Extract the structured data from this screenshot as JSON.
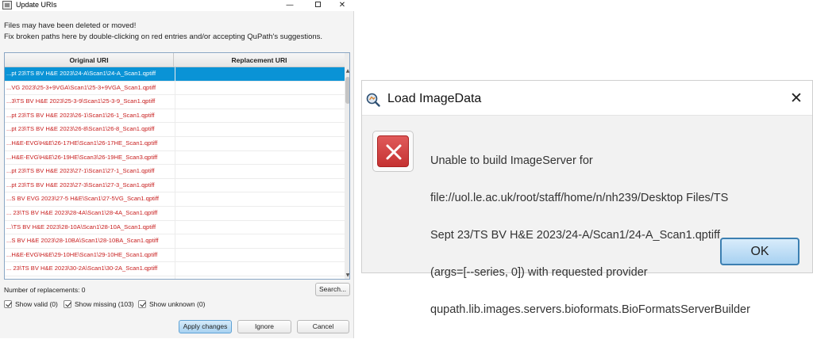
{
  "update_uris": {
    "title": "Update URIs",
    "controls": {
      "minimize": "—",
      "close": "✕"
    },
    "instructions": [
      "Files may have been deleted or moved!",
      "Fix broken paths here by double-clicking on red entries and/or accepting QuPath's suggestions."
    ],
    "columns": [
      "Original URI",
      "Replacement URI"
    ],
    "rows": [
      {
        "original": "...pt 23\\TS BV H&E 2023\\24-A\\Scan1\\24-A_Scan1.qptiff",
        "replacement": "",
        "selected": true
      },
      {
        "original": "...VG 2023\\25-3+9VGA\\Scan1\\25-3+9VGA_Scan1.qptiff",
        "replacement": ""
      },
      {
        "original": "...3\\TS BV H&E 2023\\25-3-9\\Scan1\\25-3-9_Scan1.qptiff",
        "replacement": ""
      },
      {
        "original": "...pt 23\\TS BV H&E 2023\\26-1\\Scan1\\26-1_Scan1.qptiff",
        "replacement": ""
      },
      {
        "original": "...pt 23\\TS BV H&E 2023\\26-8\\Scan1\\26-8_Scan1.qptiff",
        "replacement": ""
      },
      {
        "original": "...H&E-EVG\\H&E\\26-17HE\\Scan1\\26-17HE_Scan1.qptiff",
        "replacement": ""
      },
      {
        "original": "...H&E-EVG\\H&E\\26-19HE\\Scan3\\26-19HE_Scan3.qptiff",
        "replacement": ""
      },
      {
        "original": "...pt 23\\TS BV H&E 2023\\27-1\\Scan1\\27-1_Scan1.qptiff",
        "replacement": ""
      },
      {
        "original": "...pt 23\\TS BV H&E 2023\\27-3\\Scan1\\27-3_Scan1.qptiff",
        "replacement": ""
      },
      {
        "original": "...S BV EVG 2023\\27-5 H&E\\Scan1\\27-5VG_Scan1.qptiff",
        "replacement": ""
      },
      {
        "original": "... 23\\TS BV H&E 2023\\28-4A\\Scan1\\28-4A_Scan1.qptiff",
        "replacement": ""
      },
      {
        "original": "...\\TS BV H&E 2023\\28-10A\\Scan1\\28-10A_Scan1.qptiff",
        "replacement": ""
      },
      {
        "original": "...S BV H&E 2023\\28-10BA\\Scan1\\28-10BA_Scan1.qptiff",
        "replacement": ""
      },
      {
        "original": "...H&E-EVG\\H&E\\29-10HE\\Scan1\\29-10HE_Scan1.qptiff",
        "replacement": ""
      },
      {
        "original": "... 23\\TS BV H&E 2023\\30-2A\\Scan1\\30-2A_Scan1.qptiff",
        "replacement": ""
      },
      {
        "original": "...pt 23\\TS BV H&E 2023\\30-3\\Scan1\\30-3_Scan1.qptiff",
        "replacement": ""
      }
    ],
    "num_replacements_label": "Number of replacements: 0",
    "search_label": "Search...",
    "checkboxes": [
      {
        "label": "Show valid (0)",
        "checked": true
      },
      {
        "label": "Show missing (103)",
        "checked": true
      },
      {
        "label": "Show unknown (0)",
        "checked": true
      }
    ],
    "buttons": {
      "apply": "Apply changes",
      "ignore": "Ignore",
      "cancel": "Cancel"
    },
    "colors": {
      "missing_text": "#c81e1e",
      "selection": "#0a93d6"
    }
  },
  "load_imagedata": {
    "title": "Load ImageData",
    "close": "✕",
    "icon": "qupath-logo-icon",
    "error_icon": "error-x-icon",
    "message_lines": [
      "Unable to build ImageServer for",
      "file://uol.le.ac.uk/root/staff/home/n/nh239/Desktop Files/TS",
      "Sept 23/TS BV H&E 2023/24-A/Scan1/24-A_Scan1.qptiff",
      "(args=[--series, 0]) with requested provider",
      "qupath.lib.images.servers.bioformats.BioFormatsServerBuilder"
    ],
    "ok_label": "OK",
    "colors": {
      "error_red": "#c53232",
      "ok_border": "#3c7fb1"
    }
  }
}
